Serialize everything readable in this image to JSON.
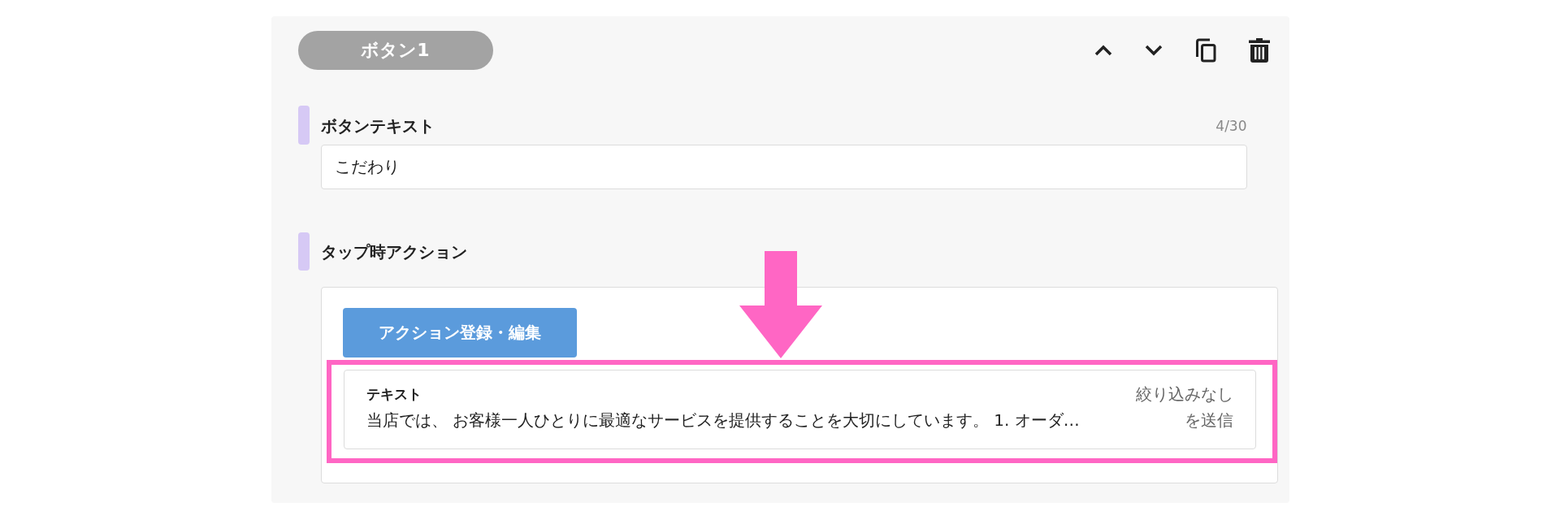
{
  "block": {
    "title": "ボタン1"
  },
  "button_text": {
    "label": "ボタンテキスト",
    "counter": "4/30",
    "value": "こだわり"
  },
  "tap_action": {
    "label": "タップ時アクション",
    "edit_button": "アクション登録・編集",
    "actions": [
      {
        "title": "テキスト",
        "filter": "絞り込みなし",
        "content": "当店では、 お客様一人ひとりに最適なサービスを提供することを大切にしています。 1. オーダ…",
        "suffix": "を送信"
      }
    ]
  }
}
